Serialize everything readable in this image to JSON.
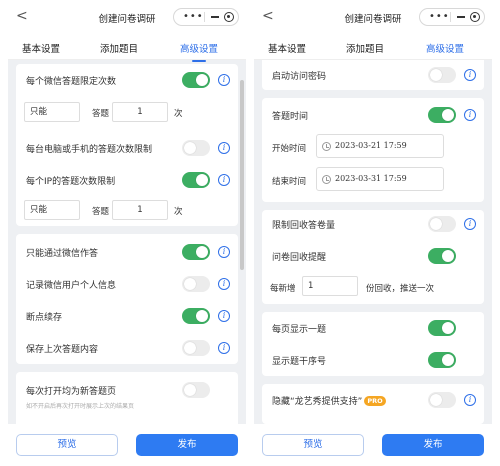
{
  "colors": {
    "accent": "#2e6fe8",
    "toggle_on": "#3cae62",
    "toggle_off": "#ececec",
    "publish": "#2e7bf2",
    "pro_badge": "#f5a623"
  },
  "left": {
    "header": {
      "back": "<",
      "title": "创建问卷调研",
      "dots": "•••"
    },
    "tabs": [
      "基本设置",
      "添加题目",
      "高级设置"
    ],
    "settings": {
      "wechat_limit": {
        "label": "每个微信答题限定次数",
        "toggle_on": true
      },
      "wechat_limit_values": {
        "prefix": "只能",
        "middle": "答题",
        "count": "1",
        "unit": "次"
      },
      "device_limit": {
        "label": "每台电脑或手机的答题次数限制",
        "toggle_on": false
      },
      "ip_limit": {
        "label": "每个IP的答题次数限制",
        "toggle_on": true
      },
      "ip_limit_values": {
        "prefix": "只能",
        "middle": "答题",
        "count": "1",
        "unit": "次"
      },
      "wechat_only": {
        "label": "只能通过微信作答",
        "toggle_on": true
      },
      "record_user": {
        "label": "记录微信用户个人信息",
        "toggle_on": false
      },
      "resume": {
        "label": "断点续存",
        "toggle_on": true
      },
      "keep_last": {
        "label": "保存上次答题内容",
        "toggle_on": false
      },
      "new_page": {
        "label": "每次打开均为新答题页",
        "hint": "如不开启后再次打开时展示上次的结果页",
        "toggle_on": false
      }
    },
    "footer": {
      "preview": "预览",
      "publish": "发布"
    }
  },
  "right": {
    "header": {
      "back": "<",
      "title": "创建问卷调研",
      "dots": "•••"
    },
    "tabs": [
      "基本设置",
      "添加题目",
      "高级设置"
    ],
    "settings": {
      "access_password": {
        "label": "启动访问密码",
        "toggle_on": false
      },
      "answer_time": {
        "label": "答题时间",
        "toggle_on": true
      },
      "start_time": {
        "label": "开始时间",
        "value": "2023-03-21 17:59"
      },
      "end_time": {
        "label": "结束时间",
        "value": "2023-03-31 17:59"
      },
      "limit_collect": {
        "label": "限制回收答卷量",
        "toggle_on": false
      },
      "remind": {
        "label": "问卷回收提醒",
        "toggle_on": true
      },
      "remind_values": {
        "prefix": "每新增",
        "count": "1",
        "suffix": "份回收，推送一次"
      },
      "one_per_page": {
        "label": "每页显示一题",
        "toggle_on": true
      },
      "show_number": {
        "label": "显示题干序号",
        "toggle_on": true
      },
      "hide_brand": {
        "label": "隐藏“龙艺秀提供支持”",
        "badge": "PRO",
        "toggle_on": false
      }
    },
    "footer": {
      "preview": "预览",
      "publish": "发布"
    }
  }
}
